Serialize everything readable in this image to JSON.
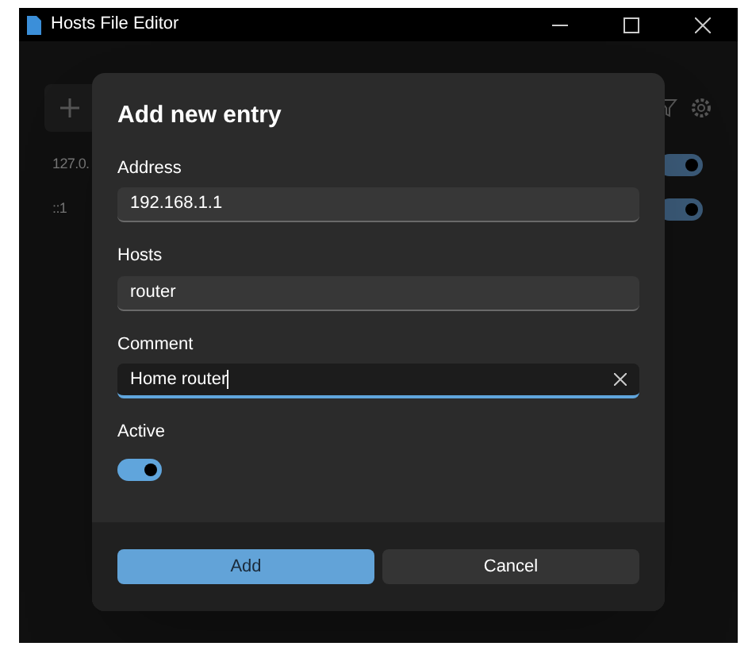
{
  "window": {
    "title": "Hosts File Editor"
  },
  "background": {
    "entries": [
      {
        "address": "127.0.",
        "active": true
      },
      {
        "address": "::1",
        "active": true
      }
    ]
  },
  "dialog": {
    "title": "Add new entry",
    "fields": [
      {
        "label": "Address",
        "value": "192.168.1.1",
        "focused": false
      },
      {
        "label": "Hosts",
        "value": "router",
        "focused": false
      },
      {
        "label": "Comment",
        "value": "Home router",
        "focused": true
      }
    ],
    "active": {
      "label": "Active",
      "on": true
    },
    "buttons": [
      {
        "label": "Add",
        "kind": "primary"
      },
      {
        "label": "Cancel",
        "kind": "secondary"
      }
    ]
  }
}
